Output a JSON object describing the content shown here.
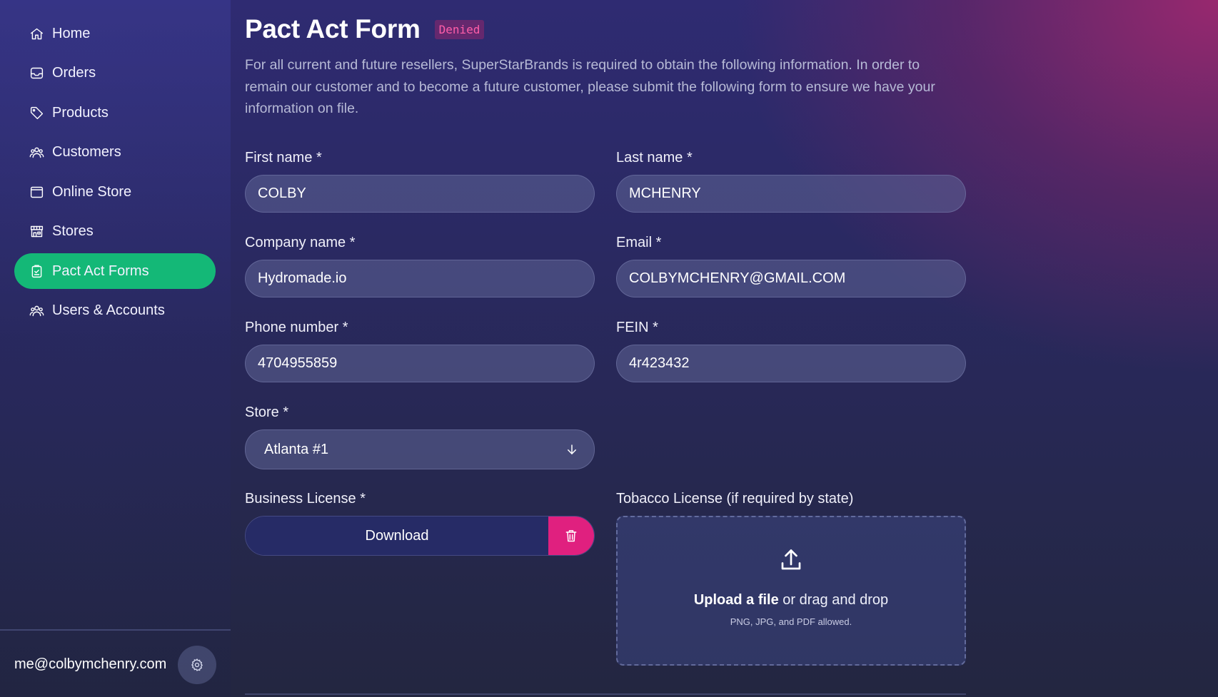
{
  "sidebar": {
    "items": [
      {
        "label": "Home",
        "icon": "home-icon",
        "active": false
      },
      {
        "label": "Orders",
        "icon": "inbox-icon",
        "active": false
      },
      {
        "label": "Products",
        "icon": "tag-icon",
        "active": false
      },
      {
        "label": "Customers",
        "icon": "users-icon",
        "active": false
      },
      {
        "label": "Online Store",
        "icon": "window-icon",
        "active": false
      },
      {
        "label": "Stores",
        "icon": "storefront-icon",
        "active": false
      },
      {
        "label": "Pact Act Forms",
        "icon": "clipboard-icon",
        "active": true
      },
      {
        "label": "Users & Accounts",
        "icon": "user-group-icon",
        "active": false
      }
    ],
    "user_email": "me@colbymchenry.com",
    "settings_icon": "gear-icon"
  },
  "header": {
    "title": "Pact Act Form",
    "status": "Denied"
  },
  "intro": "For all current and future resellers, SuperStarBrands is required to obtain the following information. In order to remain our customer and to become a future customer, please submit the following form to ensure we have your information on file.",
  "form": {
    "first_name": {
      "label": "First name *",
      "value": "COLBY"
    },
    "last_name": {
      "label": "Last name *",
      "value": "MCHENRY"
    },
    "company_name": {
      "label": "Company name *",
      "value": "Hydromade.io"
    },
    "email": {
      "label": "Email *",
      "value": "COLBYMCHENRY@GMAIL.COM"
    },
    "phone": {
      "label": "Phone number *",
      "value": "4704955859"
    },
    "fein": {
      "label": "FEIN *",
      "value": "4r423432"
    },
    "store": {
      "label": "Store *",
      "value": "Atlanta #1"
    },
    "business_license": {
      "label": "Business License *",
      "download_label": "Download"
    },
    "tobacco_license": {
      "label": "Tobacco License (if required by state)",
      "upload_bold": "Upload a file",
      "upload_rest": " or drag and drop",
      "hint": "PNG, JPG, and PDF allowed."
    }
  },
  "colors": {
    "active_nav": "#14b877",
    "delete": "#e0207f",
    "badge_text": "#ff5ea9"
  }
}
